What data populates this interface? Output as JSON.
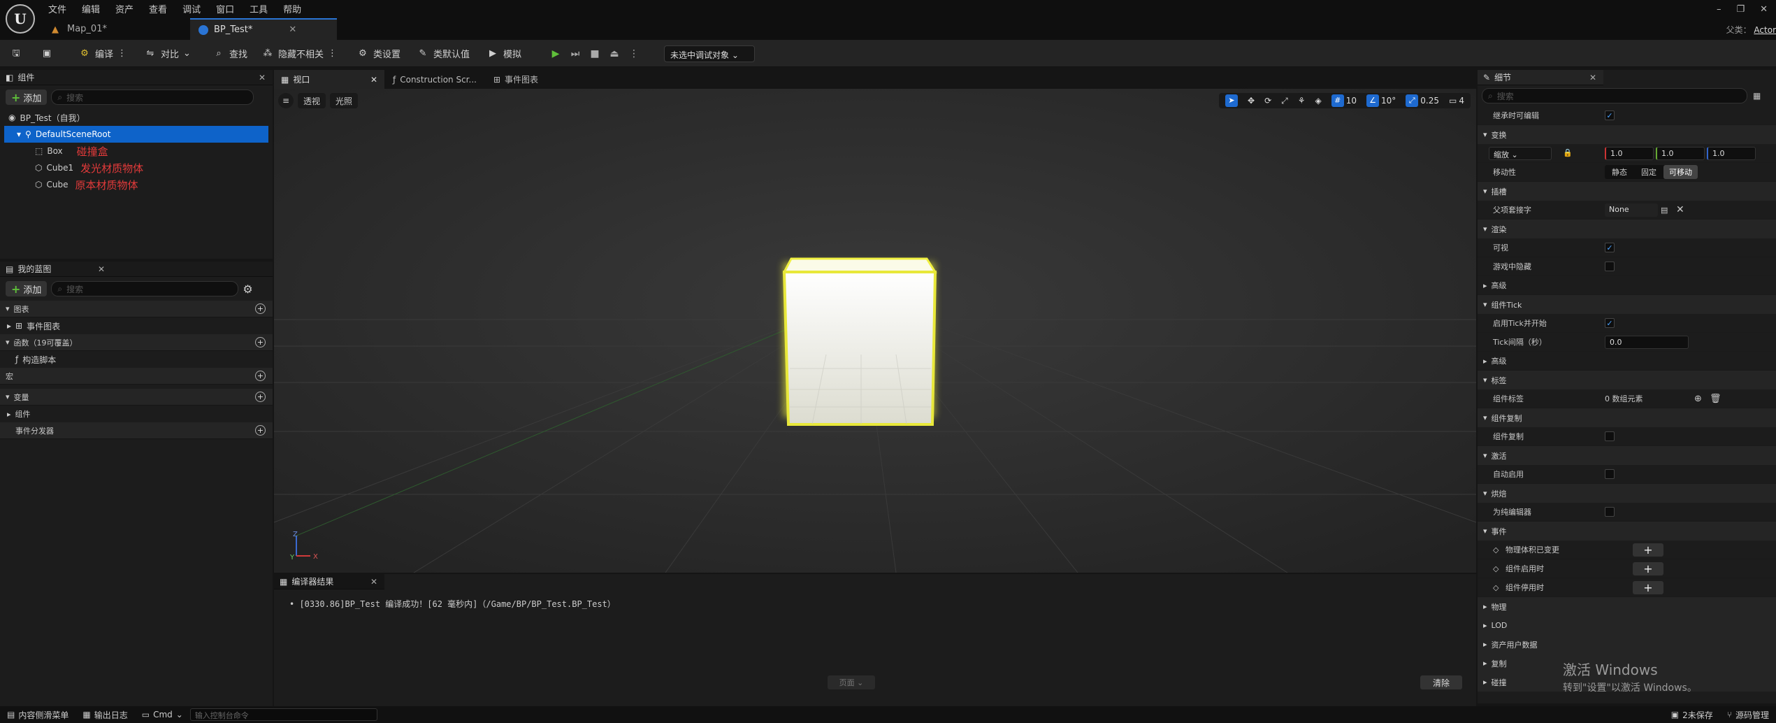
{
  "menu": [
    "文件",
    "编辑",
    "资产",
    "查看",
    "调试",
    "窗口",
    "工具",
    "帮助"
  ],
  "tabs": [
    {
      "label": "Map_01*"
    },
    {
      "label": "BP_Test*"
    }
  ],
  "window_controls": {
    "minimize": "–",
    "restore": "❐",
    "close": "✕"
  },
  "parent": {
    "label": "父类：",
    "value": "Actor"
  },
  "toolbar": {
    "compile": "编译",
    "diff": "对比",
    "find": "查找",
    "hide_unrelated": "隐藏不相关",
    "class_settings": "类设置",
    "class_defaults": "类默认值",
    "simulate": "模拟",
    "debug_object": "未选中调试对象"
  },
  "components": {
    "title": "组件",
    "add": "添加",
    "search_placeholder": "搜索",
    "items": [
      {
        "name": "BP_Test（自我）"
      },
      {
        "name": "DefaultSceneRoot"
      },
      {
        "name": "Box",
        "note": "碰撞盒"
      },
      {
        "name": "Cube1",
        "note": "发光材质物体"
      },
      {
        "name": "Cube",
        "note": "原本材质物体"
      }
    ]
  },
  "myblueprint": {
    "title": "我的蓝图",
    "add": "添加",
    "search_placeholder": "搜索",
    "graphs": "图表",
    "event_graph": "事件图表",
    "functions": "函数（19可覆盖）",
    "construction": "构造脚本",
    "macros": "宏",
    "variables": "变量",
    "components": "组件",
    "dispatchers": "事件分发器"
  },
  "center_tabs": [
    "视口",
    "Construction Scr...",
    "事件图表"
  ],
  "viewport": {
    "perspective": "透视",
    "lit": "光照",
    "grid_snap": "10",
    "rot_snap": "10°",
    "scale_snap": "0.25",
    "cam_speed": "4"
  },
  "compiler": {
    "title": "编译器结果",
    "message": "[0330.86]BP_Test 编译成功！[62 毫秒内]（/Game/BP/BP_Test.BP_Test）",
    "page": "页面",
    "clear": "清除"
  },
  "details": {
    "title": "细节",
    "search_placeholder": "搜索",
    "inherit_editable": "继承时可编辑",
    "transform": "变换",
    "scale_label": "缩放",
    "scale": [
      "1.0",
      "1.0",
      "1.0"
    ],
    "mobility": "移动性",
    "mobility_opts": [
      "静态",
      "固定",
      "可移动"
    ],
    "sockets": "插槽",
    "parent_socket": "父项套接字",
    "parent_socket_val": "None",
    "rendering": "渲染",
    "visible": "可视",
    "hidden_in_game": "游戏中隐藏",
    "advanced": "高级",
    "component_tick": "组件Tick",
    "start_with_tick": "启用Tick并开始",
    "tick_interval": "Tick间隔（秒）",
    "tick_interval_val": "0.0",
    "advanced2": "高级",
    "tags": "标签",
    "component_tags": "组件标签",
    "tags_val": "0 数组元素",
    "replication": "组件复制",
    "component_replicates": "组件复制",
    "activation": "激活",
    "auto_activate": "自动启用",
    "cooking": "烘焙",
    "editor_only": "为纯编辑器",
    "events": "事件",
    "event_items": [
      "物理体积已变更",
      "组件启用时",
      "组件停用时"
    ],
    "physics": "物理",
    "lod": "LOD",
    "asset_user_data": "资产用户数据",
    "replication2": "复制",
    "collision": "碰撞"
  },
  "watermark": {
    "line1": "激活 Windows",
    "line2": "转到\"设置\"以激活 Windows。"
  },
  "status": {
    "content_drawer": "内容侧滑菜单",
    "output_log": "输出日志",
    "cmd": "Cmd",
    "console_placeholder": "输入控制台命令",
    "unsaved": "2未保存",
    "source_control": "源码管理"
  }
}
